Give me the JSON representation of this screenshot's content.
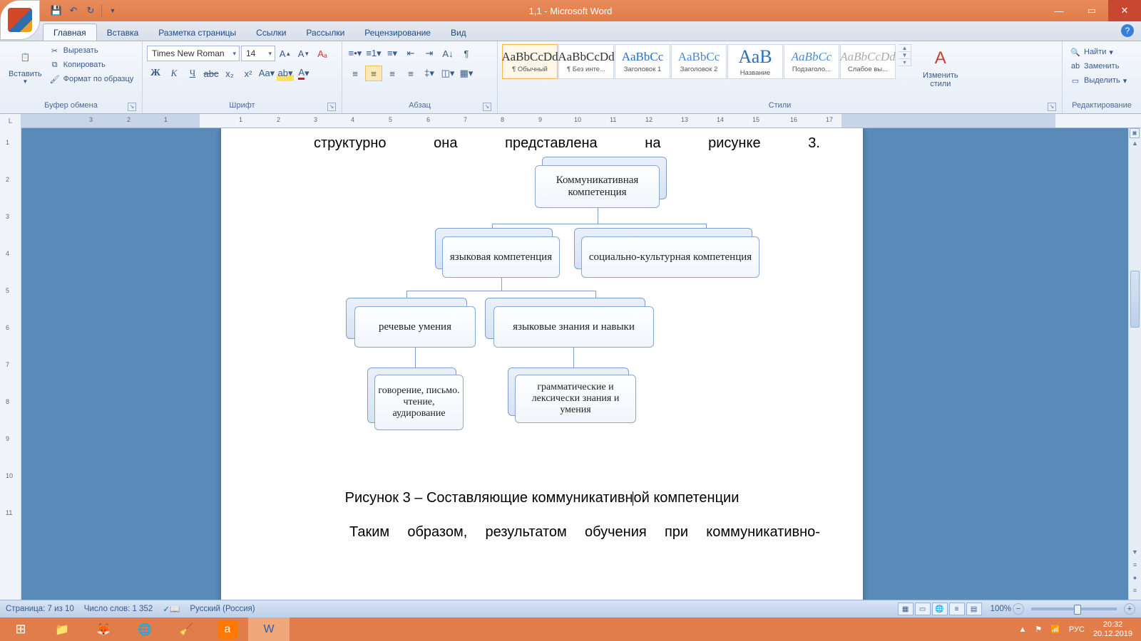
{
  "title": "1,1 - Microsoft Word",
  "tabs": [
    "Главная",
    "Вставка",
    "Разметка страницы",
    "Ссылки",
    "Рассылки",
    "Рецензирование",
    "Вид"
  ],
  "active_tab": 0,
  "clipboard": {
    "paste": "Вставить",
    "cut": "Вырезать",
    "copy": "Копировать",
    "format_painter": "Формат по образцу",
    "label": "Буфер обмена"
  },
  "font": {
    "name": "Times New Roman",
    "size": "14",
    "label": "Шрифт"
  },
  "paragraph": {
    "label": "Абзац"
  },
  "styles": {
    "label": "Стили",
    "items": [
      {
        "preview": "AaBbCcDd",
        "name": "¶ Обычный",
        "cls": ""
      },
      {
        "preview": "AaBbCcDd",
        "name": "¶ Без инте...",
        "cls": ""
      },
      {
        "preview": "AaBbCc",
        "name": "Заголовок 1",
        "cls": "blue"
      },
      {
        "preview": "AaBbCc",
        "name": "Заголовок 2",
        "cls": "blue2"
      },
      {
        "preview": "АаВ",
        "name": "Название",
        "cls": "blue lg"
      },
      {
        "preview": "AaBbCc",
        "name": "Подзаголо...",
        "cls": "blue2 it"
      },
      {
        "preview": "AaBbCcDd",
        "name": "Слабое вы...",
        "cls": "gray it"
      }
    ],
    "change": "Изменить",
    "change2": "стили"
  },
  "editing": {
    "label": "Редактирование",
    "find": "Найти",
    "replace": "Заменить",
    "select": "Выделить"
  },
  "ruler_nums": [
    "3",
    "2",
    "1",
    "1",
    "2",
    "3",
    "4",
    "5",
    "6",
    "7",
    "8",
    "9",
    "10",
    "11",
    "12",
    "13",
    "14",
    "15",
    "16",
    "17"
  ],
  "vruler_nums": [
    "1",
    "2",
    "3",
    "4",
    "5",
    "6",
    "7",
    "8",
    "9",
    "10",
    "11"
  ],
  "doc": {
    "line1": [
      "структурно",
      "она",
      "представлена",
      "на",
      "рисунке",
      "3."
    ],
    "caption_a": "Рисунок 3 – Составляющие коммуникативн",
    "caption_b": "ой компетенции",
    "line2": [
      "Таким",
      "образом,",
      "результатом",
      "обучения",
      "при",
      "коммуникативно-"
    ]
  },
  "diagram": {
    "n1": "Коммуникативная компетенция",
    "n2": "языковая компетенция",
    "n3": "социально-культурная компетенция",
    "n4": "речевые умения",
    "n5": "языковые знания и навыки",
    "n6": "говорение, письмо. чтение, аудирование",
    "n7": "грамматические и лексически знания и умения"
  },
  "status": {
    "page": "Страница: 7 из 10",
    "words": "Число слов: 1 352",
    "lang": "Русский (Россия)",
    "zoom": "100%"
  },
  "tray": {
    "lang": "РУС",
    "time": "20:32",
    "date": "20.12.2019"
  }
}
